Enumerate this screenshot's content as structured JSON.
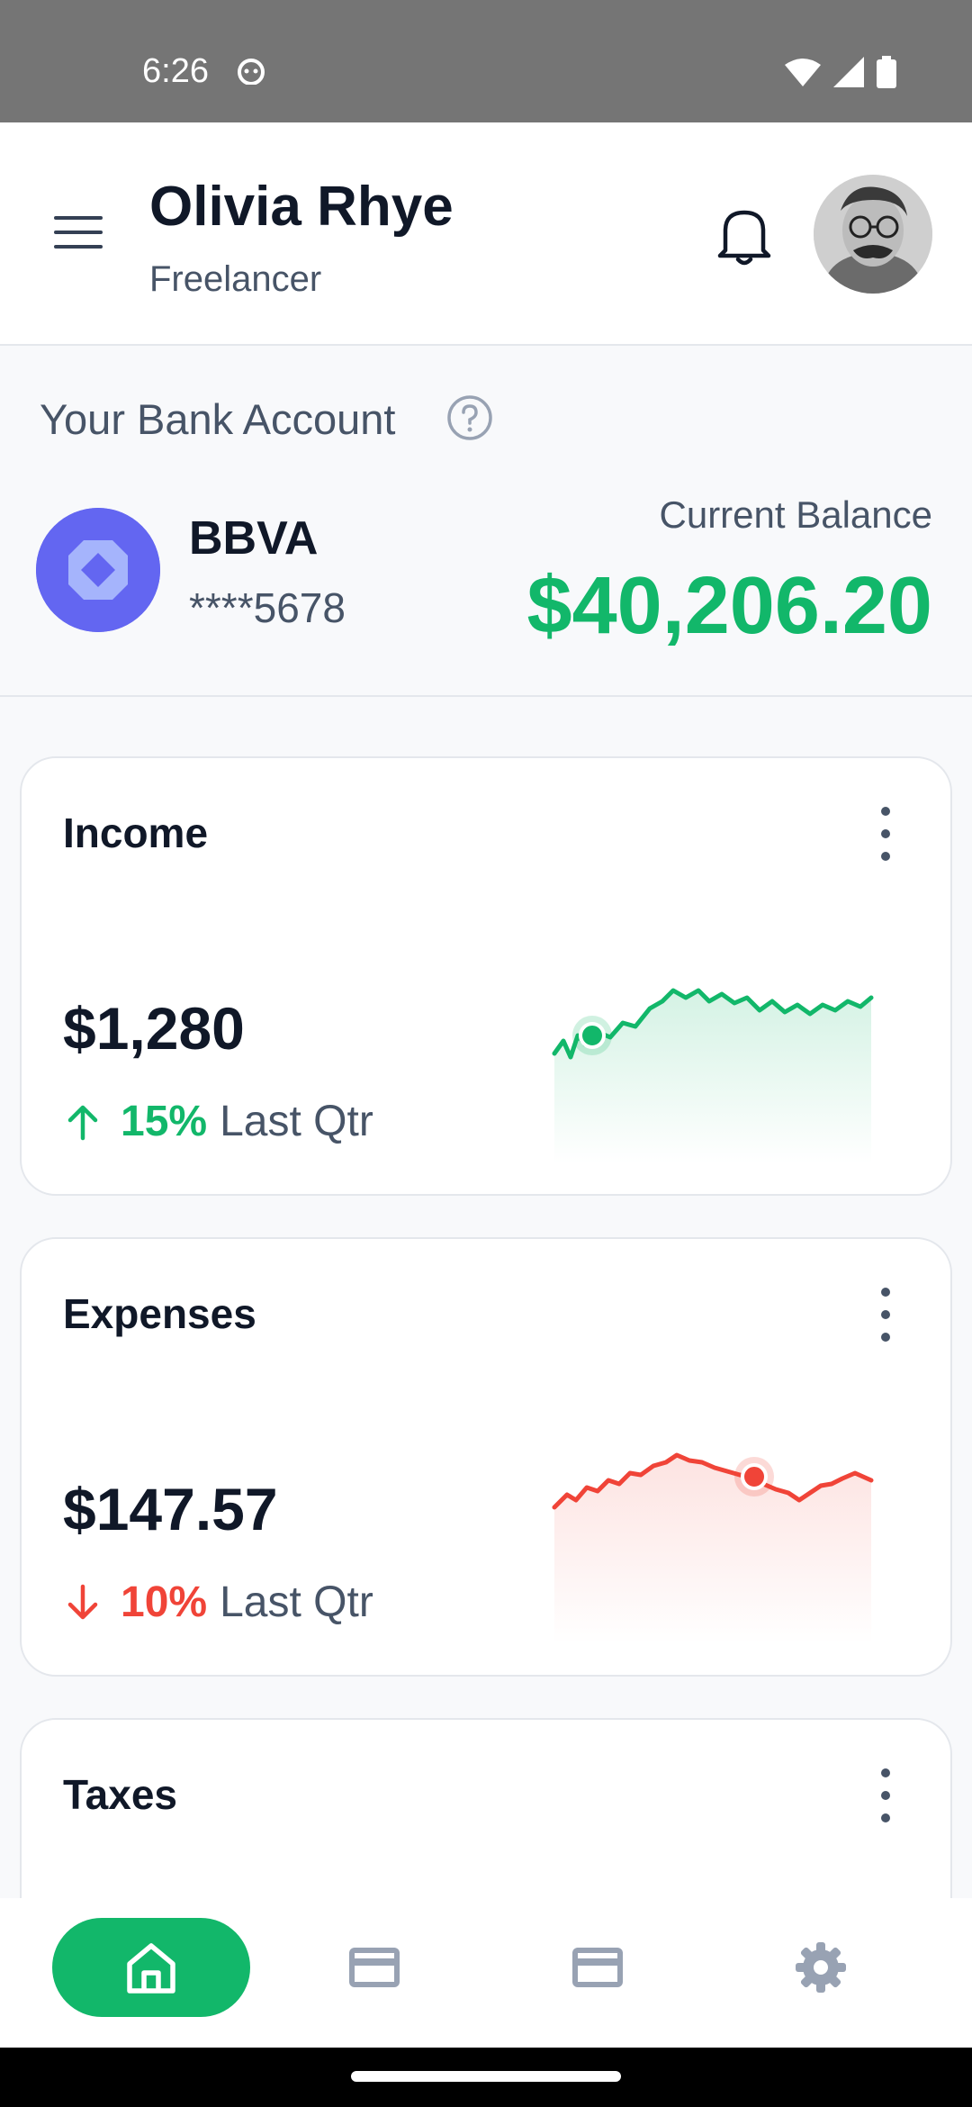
{
  "status_bar": {
    "time": "6:26"
  },
  "header": {
    "name": "Olivia Rhye",
    "role": "Freelancer"
  },
  "bank": {
    "title": "Your Bank Account",
    "name": "BBVA",
    "account_number": "****5678",
    "balance_label": "Current Balance",
    "balance_value": "$40,206.20"
  },
  "cards": [
    {
      "title": "Income",
      "amount": "$1,280",
      "trend_direction": "up",
      "trend_percent": "15%",
      "trend_label": "Last Qtr",
      "color": "#12b76a"
    },
    {
      "title": "Expenses",
      "amount": "$147.57",
      "trend_direction": "down",
      "trend_percent": "10%",
      "trend_label": "Last Qtr",
      "color": "#f04438"
    },
    {
      "title": "Taxes"
    }
  ],
  "bottom_nav": {
    "items": [
      {
        "icon": "home-icon",
        "active": true
      },
      {
        "icon": "credit-card-icon",
        "active": false
      },
      {
        "icon": "credit-card-icon",
        "active": false
      },
      {
        "icon": "gear-icon",
        "active": false
      }
    ]
  },
  "colors": {
    "accent": "#12b76a",
    "negative": "#f04438",
    "bank_logo": "#6366f1"
  }
}
